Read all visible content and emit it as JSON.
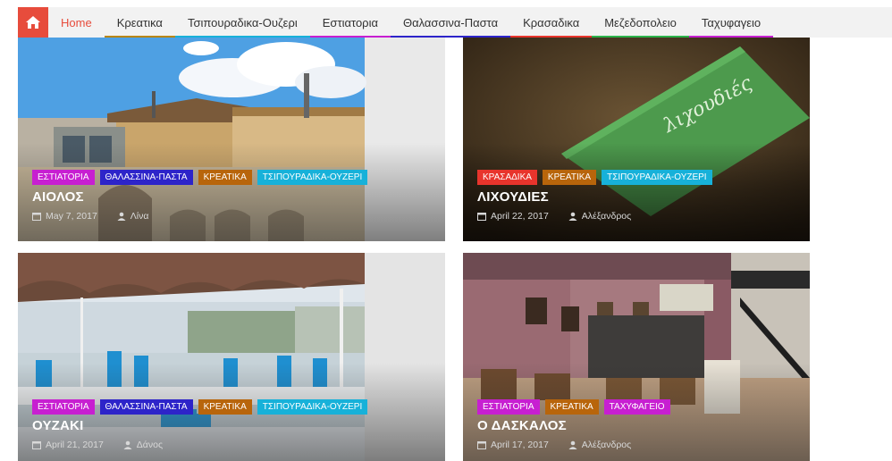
{
  "nav": {
    "home_icon": "home-icon",
    "items": [
      {
        "label": "Home",
        "color": "#e74c3c"
      },
      {
        "label": "Κρεατικα",
        "color": "#b8860b"
      },
      {
        "label": "Τσιπουραδικα-Ουζερι",
        "color": "#17b1d9"
      },
      {
        "label": "Εστιατορια",
        "color": "#c71fd1"
      },
      {
        "label": "Θαλασσινα-Παστα",
        "color": "#2d24c9"
      },
      {
        "label": "Κρασαδικα",
        "color": "#e8342c"
      },
      {
        "label": "Μεζεδοπολειο",
        "color": "#2bb34a"
      },
      {
        "label": "Ταχυφαγειο",
        "color": "#c71fd1"
      }
    ]
  },
  "posts": [
    {
      "title": "ΑΙΟΛΟΣ",
      "date": "May 7, 2017",
      "author": "Λίνα",
      "tags": [
        {
          "label": "ΕΣΤΙΑΤΟΡΙΑ",
          "color": "#c71fd1"
        },
        {
          "label": "ΘΑΛΑΣΣΙΝΑ-ΠΑΣΤΑ",
          "color": "#2d24c9"
        },
        {
          "label": "ΚΡΕΑΤΙΚΑ",
          "color": "#b8650b"
        },
        {
          "label": "ΤΣΙΠΟΥΡΑΔΙΚΑ-ΟΥΖΕΡΙ",
          "color": "#17b1d9"
        }
      ]
    },
    {
      "title": "ΛΙΧΟΥΔΙΕΣ",
      "date": "April 22, 2017",
      "author": "Αλέξανδρος",
      "card_text": "λιχουδιές",
      "tags": [
        {
          "label": "ΚΡΑΣΑΔΙΚΑ",
          "color": "#e8342c"
        },
        {
          "label": "ΚΡΕΑΤΙΚΑ",
          "color": "#b8650b"
        },
        {
          "label": "ΤΣΙΠΟΥΡΑΔΙΚΑ-ΟΥΖΕΡΙ",
          "color": "#17b1d9"
        }
      ]
    },
    {
      "title": "ΟΥΖΑΚΙ",
      "date": "April 21, 2017",
      "author": "Δάνος",
      "tags": [
        {
          "label": "ΕΣΤΙΑΤΟΡΙΑ",
          "color": "#c71fd1"
        },
        {
          "label": "ΘΑΛΑΣΣΙΝΑ-ΠΑΣΤΑ",
          "color": "#2d24c9"
        },
        {
          "label": "ΚΡΕΑΤΙΚΑ",
          "color": "#b8650b"
        },
        {
          "label": "ΤΣΙΠΟΥΡΑΔΙΚΑ-ΟΥΖΕΡΙ",
          "color": "#17b1d9"
        }
      ]
    },
    {
      "title": "Ο ΔΑΣΚΑΛΟΣ",
      "date": "April 17, 2017",
      "author": "Αλέξανδρος",
      "tags": [
        {
          "label": "ΕΣΤΙΑΤΟΡΙΑ",
          "color": "#c71fd1"
        },
        {
          "label": "ΚΡΕΑΤΙΚΑ",
          "color": "#b8650b"
        },
        {
          "label": "ΤΑΧΥΦΑΓΕΙΟ",
          "color": "#c71fd1"
        }
      ]
    }
  ]
}
